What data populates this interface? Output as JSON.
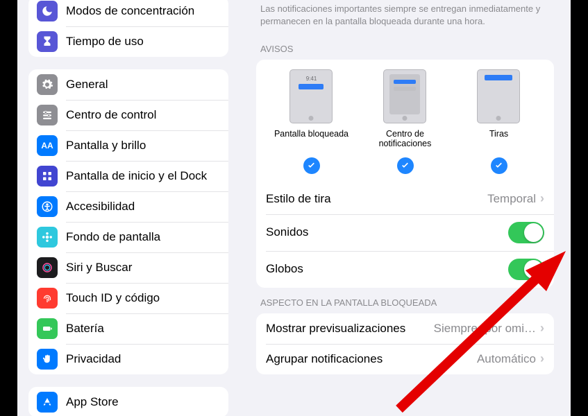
{
  "sidebar": {
    "group1": [
      {
        "label": "Modos de concentración"
      },
      {
        "label": "Tiempo de uso"
      }
    ],
    "group2": [
      {
        "label": "General"
      },
      {
        "label": "Centro de control"
      },
      {
        "label": "Pantalla y brillo"
      },
      {
        "label": "Pantalla de inicio y el Dock"
      },
      {
        "label": "Accesibilidad"
      },
      {
        "label": "Fondo de pantalla"
      },
      {
        "label": "Siri y Buscar"
      },
      {
        "label": "Touch ID y código"
      },
      {
        "label": "Batería"
      },
      {
        "label": "Privacidad"
      }
    ],
    "group3": [
      {
        "label": "App Store"
      }
    ]
  },
  "detail": {
    "note": "Las notificaciones importantes siempre se entregan inmediatamente y permanecen en la pantalla bloqueada durante una hora.",
    "section_alerts_header": "AVISOS",
    "alerts": {
      "lock": {
        "label": "Pantalla bloqueada",
        "time": "9:41"
      },
      "center": {
        "label": "Centro de notificaciones"
      },
      "banner": {
        "label": "Tiras"
      }
    },
    "rows": {
      "banner_style": {
        "title": "Estilo de tira",
        "value": "Temporal"
      },
      "sounds": {
        "title": "Sonidos"
      },
      "badges": {
        "title": "Globos"
      }
    },
    "section_lock_header": "ASPECTO EN LA PANTALLA BLOQUEADA",
    "lock_rows": {
      "previews": {
        "title": "Mostrar previsualizaciones",
        "value": "Siempre (por omi…"
      },
      "grouping": {
        "title": "Agrupar notificaciones",
        "value": "Automático"
      }
    }
  }
}
